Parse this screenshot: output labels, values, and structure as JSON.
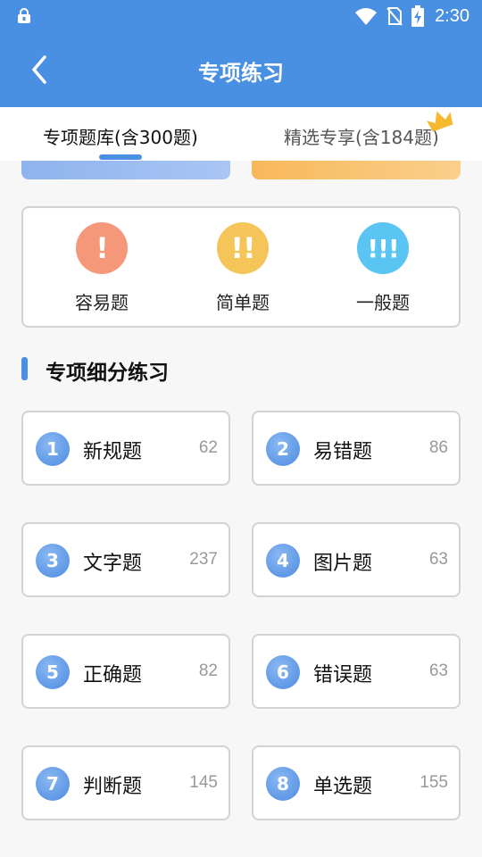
{
  "status_bar": {
    "time": "2:30"
  },
  "header": {
    "title": "专项练习"
  },
  "tabs": [
    {
      "label": "专项题库(含300题)"
    },
    {
      "label": "精选专享(含184题)"
    }
  ],
  "difficulty": [
    {
      "label": "容易题",
      "mark": "!",
      "color": "#f5987a"
    },
    {
      "label": "简单题",
      "mark": "!!",
      "color": "#f5c55a"
    },
    {
      "label": "一般题",
      "mark": "!!!",
      "color": "#5ac5f3"
    }
  ],
  "section": {
    "title": "专项细分练习"
  },
  "categories": [
    {
      "num": "1",
      "name": "新规题",
      "count": "62"
    },
    {
      "num": "2",
      "name": "易错题",
      "count": "86"
    },
    {
      "num": "3",
      "name": "文字题",
      "count": "237"
    },
    {
      "num": "4",
      "name": "图片题",
      "count": "63"
    },
    {
      "num": "5",
      "name": "正确题",
      "count": "82"
    },
    {
      "num": "6",
      "name": "错误题",
      "count": "63"
    },
    {
      "num": "7",
      "name": "判断题",
      "count": "145"
    },
    {
      "num": "8",
      "name": "单选题",
      "count": "155"
    }
  ],
  "colors": {
    "primary": "#4a90e2",
    "banner_left": "#a9c6f4",
    "banner_right": "#fbd08c"
  }
}
